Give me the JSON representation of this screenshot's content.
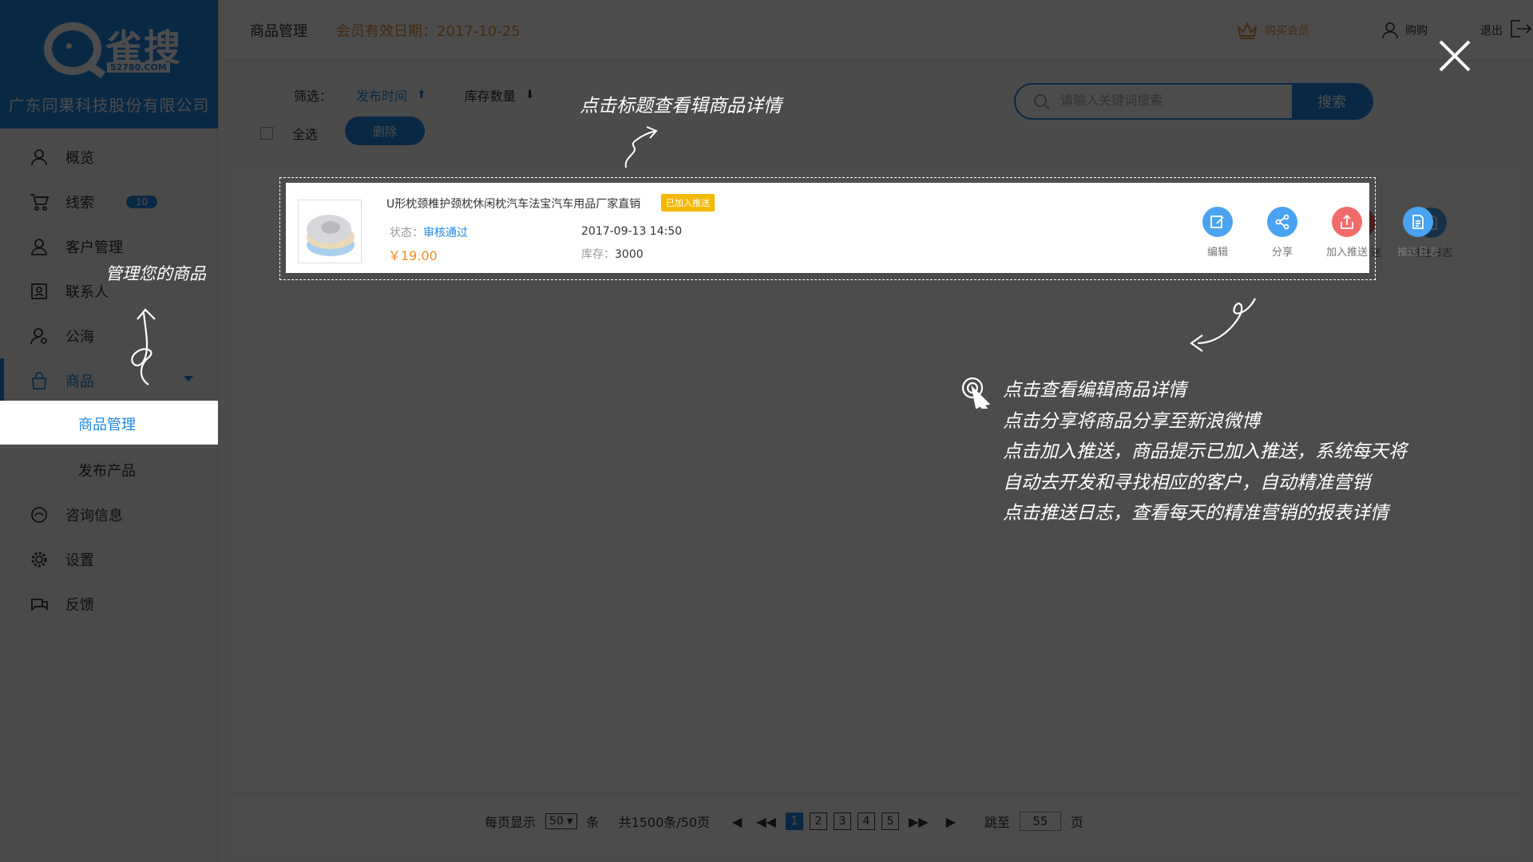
{
  "brand": {
    "name": "雀搜",
    "domain": "52780.COM",
    "company": "广东同果科技股份有限公司"
  },
  "sidebar": {
    "items": [
      {
        "label": "概览",
        "icon": "user-icon"
      },
      {
        "label": "线索",
        "icon": "cart-icon",
        "badge": "10"
      },
      {
        "label": "客户管理",
        "icon": "customer-icon"
      },
      {
        "label": "联系人",
        "icon": "contact-icon"
      },
      {
        "label": "公海",
        "icon": "public-sea-icon"
      },
      {
        "label": "商品",
        "icon": "bag-icon"
      },
      {
        "label": "咨询信息",
        "icon": "consult-icon"
      },
      {
        "label": "设置",
        "icon": "gear-icon"
      },
      {
        "label": "反馈",
        "icon": "feedback-icon"
      }
    ],
    "sub_items": [
      {
        "label": "商品管理"
      },
      {
        "label": "发布产品"
      }
    ]
  },
  "header": {
    "title": "商品管理",
    "expire": "会员有效日期：2017-10-25",
    "vip_label": "购买会员",
    "user_name": "购购",
    "logout_label": "退出"
  },
  "filter": {
    "label": "筛选：",
    "sort_time": "发布时间",
    "sort_stock": "库存数量",
    "select_all": "全选",
    "delete_label": "删除"
  },
  "search": {
    "placeholder": "请输入关键词搜索",
    "button": "搜索"
  },
  "product": {
    "title": "U形枕颈椎护颈枕休闲枕汽车法宝汽车用品厂家直销",
    "tag": "已加入推送",
    "status_label": "状态：",
    "status_value": "审核通过",
    "price": "￥19.00",
    "time": "2017-09-13 14:50",
    "stock_label": "库存：",
    "stock_value": "3000",
    "actions": [
      {
        "label": "编辑",
        "icon": "edit-icon",
        "color": "#4aa3f0"
      },
      {
        "label": "分享",
        "icon": "share-icon",
        "color": "#4aa3f0"
      },
      {
        "label": "加入推送",
        "icon": "push-icon",
        "color": "#f26b6b"
      },
      {
        "label": "推送日志",
        "icon": "log-icon",
        "color": "#4aa3f0"
      }
    ]
  },
  "pager": {
    "per_page_label": "每页显示",
    "per_page_value": "50",
    "unit": "条",
    "total": "共1500条/50页",
    "pages": [
      "1",
      "2",
      "3",
      "4",
      "5"
    ],
    "current_page": "1",
    "jump_label": "跳至",
    "jump_value": "55",
    "page_suffix": "页"
  },
  "guide": {
    "title_hint": "点击标题查看辑商品详情",
    "manage_hint": "管理您的商品",
    "lines": [
      "点击查看编辑商品详情",
      "点击分享将商品分享至新浪微博",
      "点击加入推送，商品提示已加入推送，系统每天将",
      "自动去开发和寻找相应的客户，自动精准营销",
      "点击推送日志，查看每天的精准营销的报表详情"
    ]
  },
  "colors": {
    "accent": "#1e88e5",
    "orange": "#e8923a",
    "tag": "#f5b800"
  }
}
